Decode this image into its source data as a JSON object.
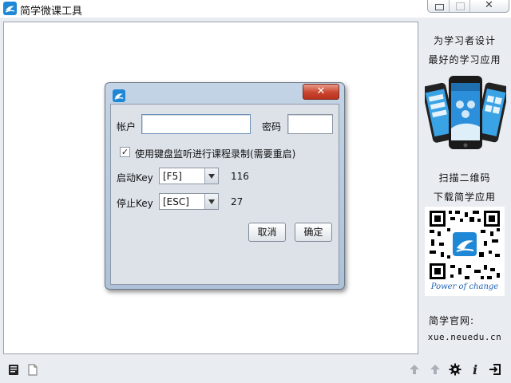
{
  "window": {
    "title": "简学微课工具",
    "icon": "app-logo-icon"
  },
  "sidebar": {
    "slogan_line1": "为学习者设计",
    "slogan_line2": "最好的学习应用",
    "scan_line1": "扫描二维码",
    "scan_line2": "下载简学应用",
    "qr_caption": "Power of change",
    "site_label": "简学官网:",
    "site_url": "xue.neuedu.cn"
  },
  "dialog": {
    "account_label": "帐户",
    "account_value": "",
    "password_label": "密码",
    "password_value": "",
    "keyboard_monitor_label": "使用键盘监听进行课程录制(需要重启)",
    "keyboard_monitor_checked": true,
    "start_key_label": "启动Key",
    "start_key_value": "[F5]",
    "start_key_code": "116",
    "stop_key_label": "停止Key",
    "stop_key_value": "[ESC]",
    "stop_key_code": "27",
    "cancel_label": "取消",
    "ok_label": "确定",
    "close_icon": "close-icon"
  },
  "toolbar": {
    "left_icons": [
      "notebook-icon",
      "document-icon"
    ],
    "right_icons": [
      "upload-icon",
      "upload-icon",
      "gear-icon",
      "info-icon",
      "exit-icon"
    ]
  },
  "colors": {
    "brand_blue": "#1e88d6",
    "close_red": "#c9452f",
    "panel_bg": "#e9ecf1"
  }
}
